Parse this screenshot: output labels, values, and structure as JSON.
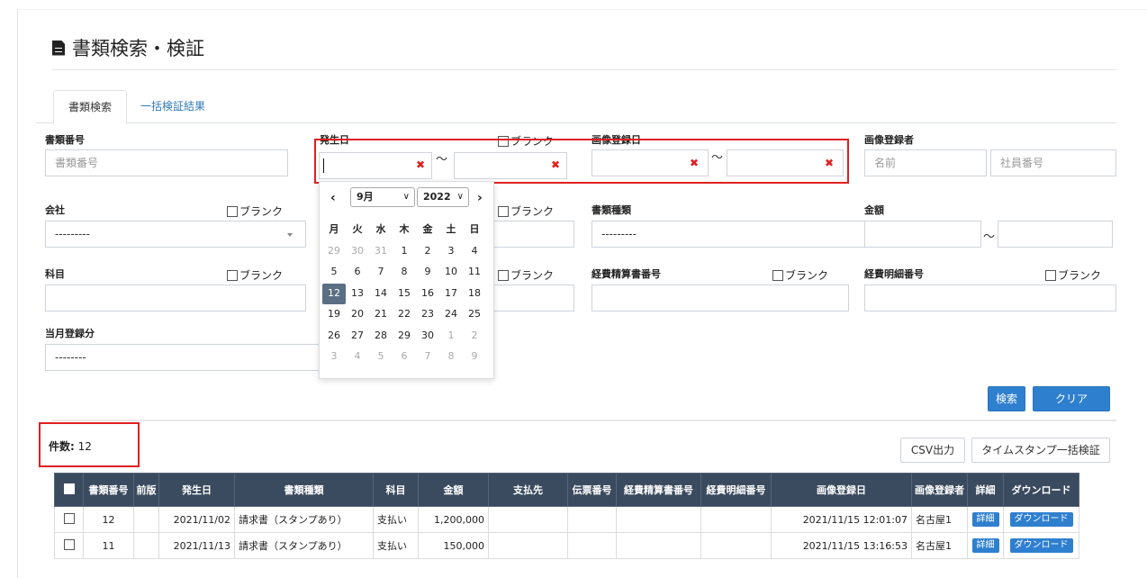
{
  "page": {
    "title": "書類検索・検証"
  },
  "tabs": [
    "書類検索",
    "一括検証結果"
  ],
  "form": {
    "doc_number_label": "書類番号",
    "doc_number_placeholder": "書類番号",
    "issue_date_label": "発生日",
    "blank": "ブランク",
    "tilde": "～",
    "image_date_label": "画像登録日",
    "image_registrant_label": "画像登録者",
    "name_placeholder": "名前",
    "employee_placeholder": "社員番号",
    "company_label": "会社",
    "company_value": "---------",
    "doc_type_label": "書類種類",
    "doc_type_value": "---------",
    "amount_label": "金額",
    "subject_label": "科目",
    "expense_report_label": "経費精算書番号",
    "expense_detail_label": "経費明細番号",
    "current_month_label": "当月登録分",
    "current_month_value": "--------"
  },
  "calendar": {
    "month": "9月",
    "year": "2022",
    "weekdays": [
      "月",
      "火",
      "水",
      "木",
      "金",
      "土",
      "日"
    ],
    "weeks": [
      [
        "29",
        "30",
        "31",
        "1",
        "2",
        "3",
        "4"
      ],
      [
        "5",
        "6",
        "7",
        "8",
        "9",
        "10",
        "11"
      ],
      [
        "12",
        "13",
        "14",
        "15",
        "16",
        "17",
        "18"
      ],
      [
        "19",
        "20",
        "21",
        "22",
        "23",
        "24",
        "25"
      ],
      [
        "26",
        "27",
        "28",
        "29",
        "30",
        "1",
        "2"
      ],
      [
        "3",
        "4",
        "5",
        "6",
        "7",
        "8",
        "9"
      ]
    ],
    "today": "12"
  },
  "buttons": {
    "search": "検索",
    "clear": "クリア",
    "csv": "CSV出力",
    "timestamp": "タイムスタンプ一括検証"
  },
  "result": {
    "count_label": "件数:",
    "count": "12"
  },
  "table": {
    "headers": [
      "書類番号",
      "前版",
      "発生日",
      "書類種類",
      "科目",
      "金額",
      "支払先",
      "伝票番号",
      "経費精算書番号",
      "経費明細番号",
      "画像登録日",
      "画像登録者",
      "詳細",
      "ダウンロード"
    ],
    "rows": [
      {
        "doc_no": "12",
        "prev": "",
        "date": "2021/11/02",
        "type": "請求書（スタンプあり）",
        "subject": "支払い",
        "amount": "1,200,000",
        "payee": "",
        "slip": "",
        "exp_report": "",
        "exp_detail": "",
        "img_date": "2021/11/15 12:01:07",
        "registrant": "名古屋1",
        "detail": "詳細",
        "download": "ダウンロード"
      },
      {
        "doc_no": "11",
        "prev": "",
        "date": "2021/11/13",
        "type": "請求書（スタンプあり）",
        "subject": "支払い",
        "amount": "150,000",
        "payee": "",
        "slip": "",
        "exp_report": "",
        "exp_detail": "",
        "img_date": "2021/11/15 13:16:53",
        "registrant": "名古屋1",
        "detail": "詳細",
        "download": "ダウンロード"
      }
    ]
  }
}
